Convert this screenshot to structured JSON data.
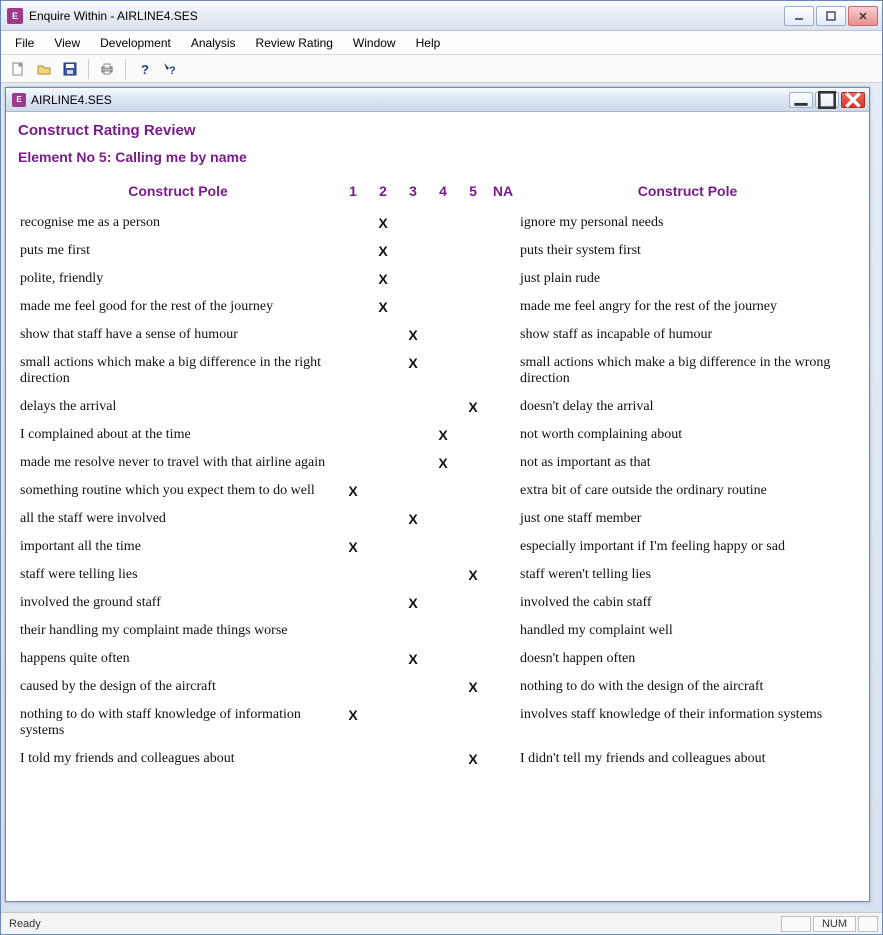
{
  "window": {
    "title": "Enquire Within - AIRLINE4.SES",
    "app_icon_label": "E"
  },
  "menus": [
    "File",
    "View",
    "Development",
    "Analysis",
    "Review Rating",
    "Window",
    "Help"
  ],
  "toolbar_icons": [
    "new",
    "open",
    "save",
    "print",
    "help-about",
    "help-context"
  ],
  "child_window": {
    "title": "AIRLINE4.SES",
    "app_icon_label": "E"
  },
  "content": {
    "section_title": "Construct Rating Review",
    "element_title": "Element No 5: Calling me by name",
    "header_left": "Construct Pole",
    "header_right": "Construct Pole",
    "rating_labels": [
      "1",
      "2",
      "3",
      "4",
      "5",
      "NA"
    ],
    "mark": "X",
    "rows": [
      {
        "left": "recognise me as a person",
        "rating": 2,
        "right": "ignore my personal needs"
      },
      {
        "left": "puts me first",
        "rating": 2,
        "right": "puts their system first"
      },
      {
        "left": "polite, friendly",
        "rating": 2,
        "right": "just plain rude"
      },
      {
        "left": "made me feel good for the rest of the journey",
        "rating": 2,
        "right": "made me feel angry for the rest of the journey"
      },
      {
        "left": "show that staff have a sense of humour",
        "rating": 3,
        "right": "show staff as incapable of humour"
      },
      {
        "left": "small actions which make a big difference in the right direction",
        "rating": 3,
        "right": "small actions which make a big difference in the wrong direction"
      },
      {
        "left": "delays the arrival",
        "rating": 5,
        "right": "doesn't delay the arrival"
      },
      {
        "left": "I complained about at the time",
        "rating": 4,
        "right": "not worth complaining about"
      },
      {
        "left": "made me resolve never to travel with that airline again",
        "rating": 4,
        "right": "not as important as that"
      },
      {
        "left": "something routine which you expect them to do well",
        "rating": 1,
        "right": "extra bit of care outside the ordinary routine"
      },
      {
        "left": "all the staff were involved",
        "rating": 3,
        "right": "just one staff member"
      },
      {
        "left": "important all the time",
        "rating": 1,
        "right": "especially important if I'm feeling happy or sad"
      },
      {
        "left": "staff were telling lies",
        "rating": 5,
        "right": "staff weren't telling lies"
      },
      {
        "left": "involved the ground staff",
        "rating": 3,
        "right": "involved the cabin staff"
      },
      {
        "left": "their handling my complaint made things worse",
        "rating": 0,
        "right": "handled my complaint well"
      },
      {
        "left": "happens quite often",
        "rating": 3,
        "right": "doesn't happen often"
      },
      {
        "left": "caused by the design of the aircraft",
        "rating": 5,
        "right": "nothing to do with the design of the aircraft"
      },
      {
        "left": "nothing to do with staff knowledge of information systems",
        "rating": 1,
        "right": "involves staff knowledge of their information systems"
      },
      {
        "left": "I told my friends and colleagues about",
        "rating": 5,
        "right": "I didn't tell my friends and colleagues about"
      }
    ]
  },
  "statusbar": {
    "ready": "Ready",
    "num": "NUM"
  }
}
